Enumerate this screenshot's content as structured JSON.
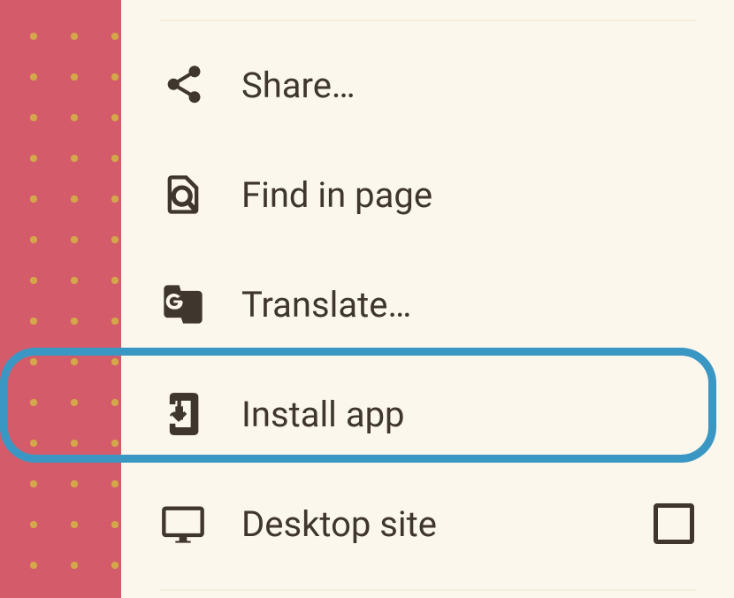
{
  "menu": {
    "share": {
      "label": "Share…"
    },
    "find": {
      "label": "Find in page"
    },
    "translate": {
      "label": "Translate…"
    },
    "install": {
      "label": "Install app"
    },
    "desktop": {
      "label": "Desktop site",
      "checked": false
    }
  },
  "highlight_target": "install-app"
}
